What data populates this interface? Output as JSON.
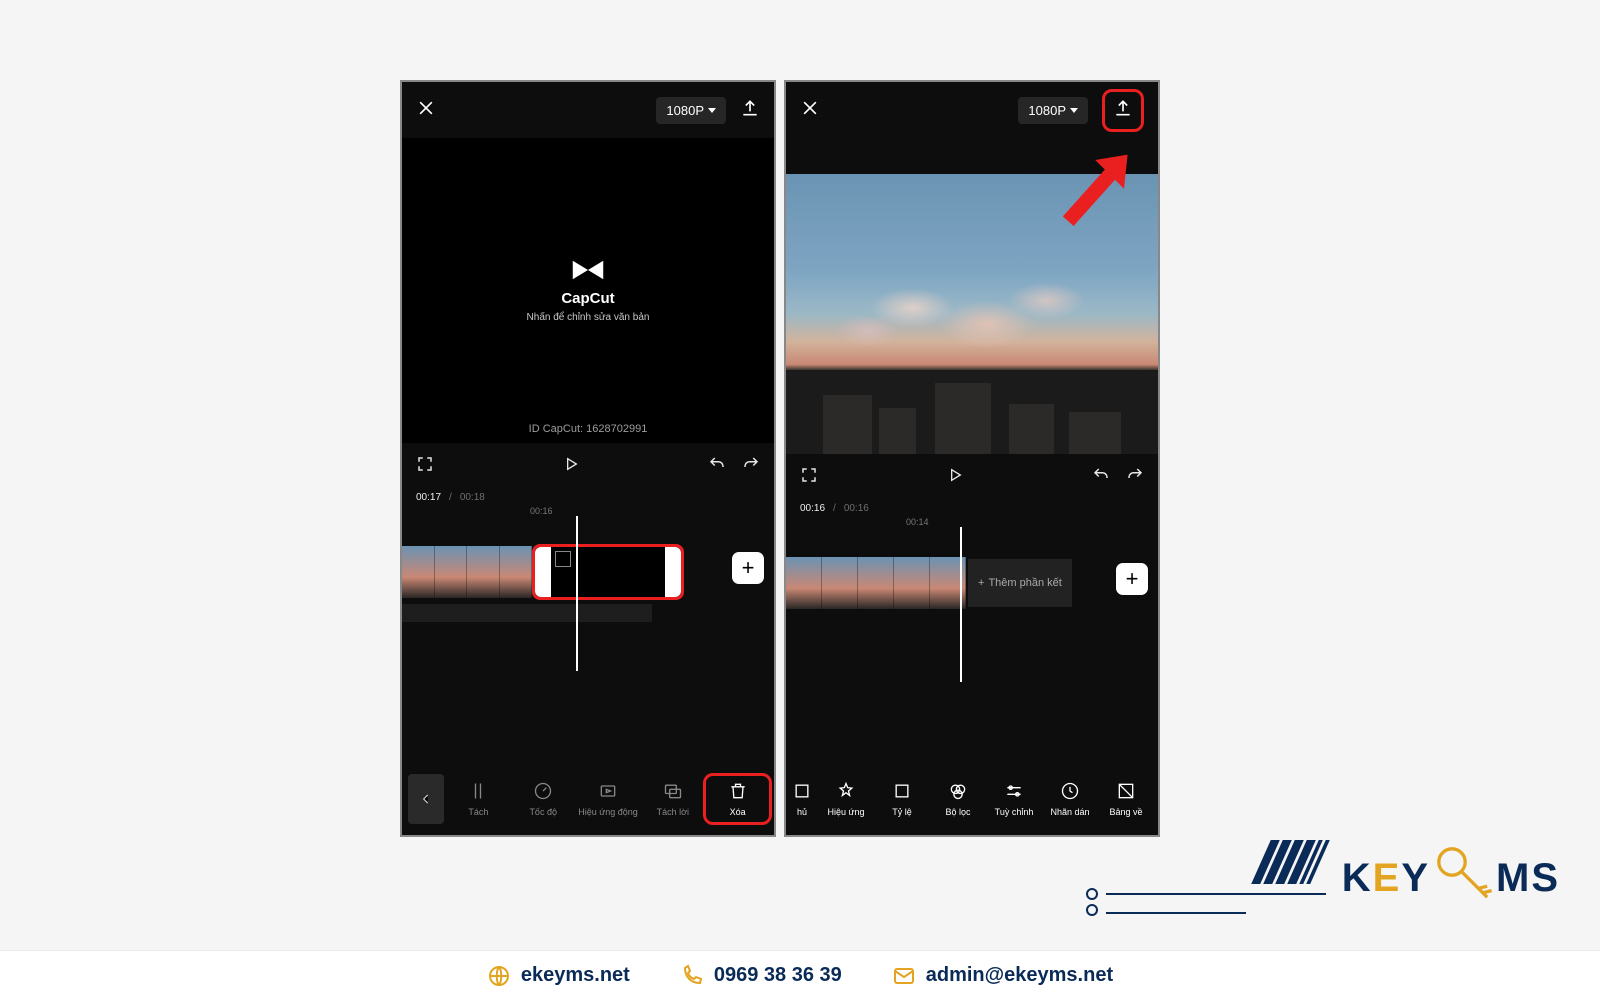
{
  "left": {
    "top": {
      "resolution": "1080P"
    },
    "preview": {
      "brand": "CapCut",
      "subtitle": "Nhấn để chỉnh sửa văn bản",
      "id_label": "ID CapCut: 1628702991"
    },
    "time": {
      "current": "00:17",
      "total": "00:18",
      "marker": "00:16"
    },
    "tools": [
      {
        "label": "Tách"
      },
      {
        "label": "Tốc độ"
      },
      {
        "label": "Hiệu ứng động"
      },
      {
        "label": "Tách lời"
      },
      {
        "label": "Xóa"
      }
    ]
  },
  "right": {
    "top": {
      "resolution": "1080P"
    },
    "time": {
      "current": "00:16",
      "total": "00:16",
      "marker": "00:14"
    },
    "end_card": "Thêm phần kết",
    "tools": [
      {
        "label": "hủ"
      },
      {
        "label": "Hiệu ứng"
      },
      {
        "label": "Tỷ lệ"
      },
      {
        "label": "Bộ lọc"
      },
      {
        "label": "Tuỳ chỉnh"
      },
      {
        "label": "Nhãn dán"
      },
      {
        "label": "Bảng về"
      }
    ]
  },
  "footer": {
    "brand_a": "K",
    "brand_b": "E",
    "brand_c": "Y",
    "brand_d": "MS",
    "site": "ekeyms.net",
    "phone": "0969 38 36 39",
    "email": "admin@ekeyms.net"
  }
}
